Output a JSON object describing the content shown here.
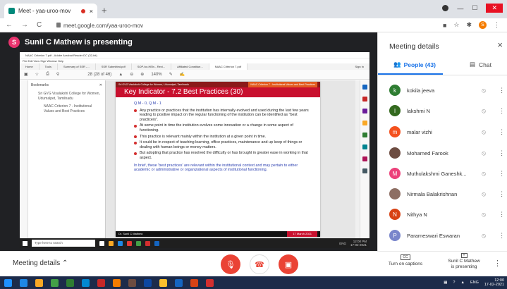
{
  "browser": {
    "tab_title": "Meet - yaa-uroo-mov",
    "new_tab": "+",
    "close_tab": "×",
    "url": "meet.google.com/yaa-uroo-mov",
    "profile_initial": "S"
  },
  "meet": {
    "presenter_initial": "S",
    "presenter_banner": "Sunil C Mathew is presenting"
  },
  "shared_screen": {
    "acrobat_title": "NAAC Criterion 7.pdf - Adobe Acrobat Reader DC (32-bit)",
    "menu": "File  Edit  View  Sign  Window  Help",
    "tabs": [
      "Home",
      "Tools",
      "Summary of SSR -...",
      "SSR Submitted.pdf",
      "SOP-for-HEIs - Revi...",
      "Affiliated Constitue...",
      "NAAC Criterion 7.pdf"
    ],
    "sign_in": "Sign In",
    "page_indicator": "28 (28 of 46)",
    "zoom": "140%",
    "bookmarks_label": "Bookmarks",
    "bookmark_1": "Sri GVG Visalakshi College for Women, Udumalpet, Tamilnadu",
    "bookmark_2": "NAAC Criterion 7 - Institutional Values and Best Practices",
    "inner_search": "Type here to search",
    "inner_time": "12:00 PM",
    "inner_date": "17-02-2021",
    "inner_lang": "ENG"
  },
  "slide": {
    "band_left": "Sri GVG Visalakshi College for Women, Udumalpet, Tamilnadu",
    "band_right": "NAAC Criterion 7 - Institutional Values and Best Practices",
    "title": "Key Indicator - 7.2 Best Practices (30)",
    "qm": "Q.M - 0,   Q.M - 1",
    "bullets": [
      "Any practice or practices that the institution has internally evolved and used during the last few years leading to positive impact on the regular functioning of the institution can be identified as \"best practice/s\".",
      "At some point in time the institution evolves some innovation or a change in some aspect of functioning.",
      "This practice is relevant mainly within the institution at a given point in time.",
      "It could be in respect of teaching learning, office practices, maintenance and up keep of things or dealing with human beings or money matters.",
      "But adopting that practice has resolved the difficulty or has brought in greater ease in working in that aspect."
    ],
    "brief": "In brief, these 'best practices' are relevant within the institutional context and may pertain to either academic or administrative or organizational aspects of institutional functioning.",
    "footer_name": "Dr. Sunil C Mathew",
    "footer_date": "17 March 2021"
  },
  "panel": {
    "title": "Meeting details",
    "close": "×",
    "people_tab": "People (43)",
    "chat_tab": "Chat",
    "people": [
      {
        "initial": "k",
        "name": "kokila jeeva",
        "color": "#2e7d32"
      },
      {
        "initial": "l",
        "name": "lakshmi N",
        "color": "#33691e"
      },
      {
        "initial": "m",
        "name": "malar vizhi",
        "color": "#f4511e"
      },
      {
        "initial": "",
        "name": "Mohamed Farook",
        "color": "#6d4c41"
      },
      {
        "initial": "M",
        "name": "Muthulakshmi Ganeshk...",
        "color": "#ec407a"
      },
      {
        "initial": "",
        "name": "Nirmala Balakrishnan",
        "color": "#8d6e63"
      },
      {
        "initial": "N",
        "name": "Nithya N",
        "color": "#d84315"
      },
      {
        "initial": "P",
        "name": "Parameswari Eswaran",
        "color": "#7986cb"
      }
    ]
  },
  "bottom": {
    "meeting_details": "Meeting details",
    "captions_icon": "CC",
    "captions": "Turn on captions",
    "presenting_line1": "Sunil C Mathew",
    "presenting_line2": "is presenting",
    "more": "⋮"
  },
  "taskbar": {
    "lang": "ENG",
    "time": "12:00",
    "date": "17-02-2021"
  }
}
